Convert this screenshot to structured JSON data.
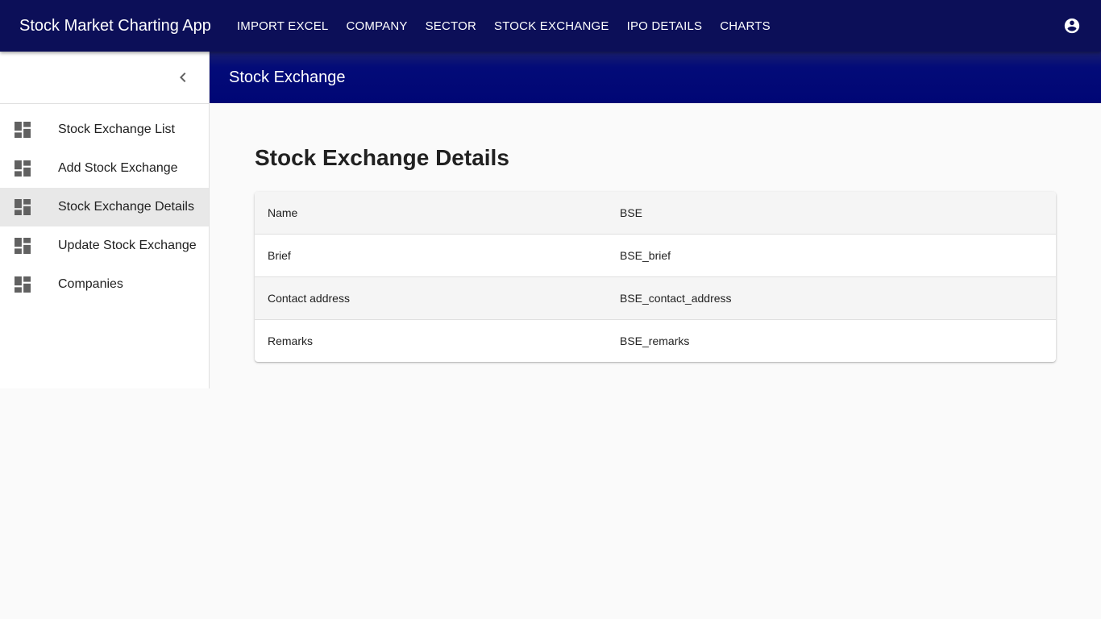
{
  "app": {
    "title": "Stock Market Charting App",
    "nav": [
      {
        "label": "IMPORT EXCEL"
      },
      {
        "label": "COMPANY"
      },
      {
        "label": "SECTOR"
      },
      {
        "label": "STOCK EXCHANGE"
      },
      {
        "label": "IPO DETAILS"
      },
      {
        "label": "CHARTS"
      }
    ],
    "account_icon": "account-circle-icon"
  },
  "sidebar": {
    "collapse_icon": "chevron-left-icon",
    "items": [
      {
        "label": "Stock Exchange List",
        "icon": "dashboard-icon",
        "active": false
      },
      {
        "label": "Add Stock Exchange",
        "icon": "dashboard-icon",
        "active": false
      },
      {
        "label": "Stock Exchange Details",
        "icon": "dashboard-icon",
        "active": true
      },
      {
        "label": "Update Stock Exchange",
        "icon": "dashboard-icon",
        "active": false
      },
      {
        "label": "Companies",
        "icon": "dashboard-icon",
        "active": false
      }
    ]
  },
  "page": {
    "section_title": "Stock Exchange",
    "heading": "Stock Exchange Details",
    "details": [
      {
        "key": "Name",
        "value": "BSE"
      },
      {
        "key": "Brief",
        "value": "BSE_brief"
      },
      {
        "key": "Contact address",
        "value": "BSE_contact_address"
      },
      {
        "key": "Remarks",
        "value": "BSE_remarks"
      }
    ]
  },
  "colors": {
    "appbar": "#0c0f58",
    "page_bar": "#000675",
    "active_item": "#e8e8e8"
  }
}
